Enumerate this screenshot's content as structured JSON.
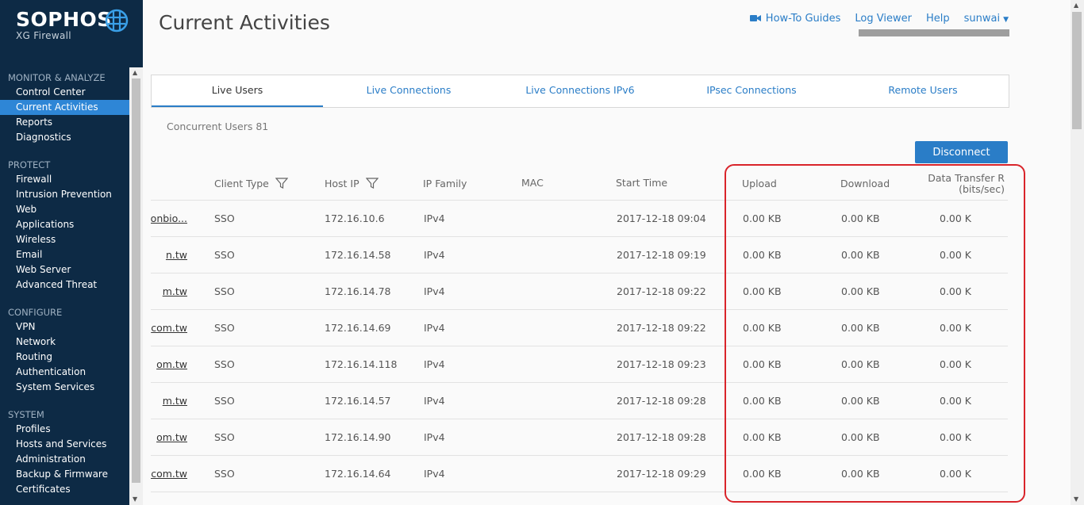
{
  "app": {
    "brand": "SOPHOS",
    "product": "XG Firewall"
  },
  "colors": {
    "sidebar_bg": "#0d2a45",
    "accent": "#2a7dc7",
    "highlight_border": "#d9242a"
  },
  "sidebar": {
    "groups": [
      {
        "header": "MONITOR & ANALYZE",
        "items": [
          "Control Center",
          "Current Activities",
          "Reports",
          "Diagnostics"
        ]
      },
      {
        "header": "PROTECT",
        "items": [
          "Firewall",
          "Intrusion Prevention",
          "Web",
          "Applications",
          "Wireless",
          "Email",
          "Web Server",
          "Advanced Threat"
        ]
      },
      {
        "header": "CONFIGURE",
        "items": [
          "VPN",
          "Network",
          "Routing",
          "Authentication",
          "System Services"
        ]
      },
      {
        "header": "SYSTEM",
        "items": [
          "Profiles",
          "Hosts and Services",
          "Administration",
          "Backup & Firmware",
          "Certificates"
        ]
      }
    ],
    "active_item": "Current Activities"
  },
  "header": {
    "title": "Current Activities",
    "links": {
      "howto": "How-To Guides",
      "log_viewer": "Log Viewer",
      "help": "Help",
      "user": "sunwai"
    }
  },
  "tabs": [
    "Live Users",
    "Live Connections",
    "Live Connections IPv6",
    "IPsec Connections",
    "Remote Users"
  ],
  "active_tab": "Live Users",
  "concurrent_users": "Concurrent Users 81",
  "disconnect_label": "Disconnect",
  "table": {
    "columns": {
      "client_type": "Client Type",
      "host_ip": "Host IP",
      "ip_family": "IP Family",
      "mac": "MAC",
      "start_time": "Start Time",
      "upload": "Upload",
      "download": "Download",
      "dtr_line1": "Data Transfer R",
      "dtr_line2": "(bits/sec)"
    },
    "rows": [
      {
        "user": "onbio...",
        "client_type": "SSO",
        "host_ip": "172.16.10.6",
        "ip_family": "IPv4",
        "mac": "",
        "start_time": "2017-12-18 09:04",
        "upload": "0.00 KB",
        "download": "0.00 KB",
        "rate": "0.00 K"
      },
      {
        "user": "n.tw",
        "client_type": "SSO",
        "host_ip": "172.16.14.58",
        "ip_family": "IPv4",
        "mac": "",
        "start_time": "2017-12-18 09:19",
        "upload": "0.00 KB",
        "download": "0.00 KB",
        "rate": "0.00 K"
      },
      {
        "user": "m.tw",
        "client_type": "SSO",
        "host_ip": "172.16.14.78",
        "ip_family": "IPv4",
        "mac": "",
        "start_time": "2017-12-18 09:22",
        "upload": "0.00 KB",
        "download": "0.00 KB",
        "rate": "0.00 K"
      },
      {
        "user": "com.tw",
        "client_type": "SSO",
        "host_ip": "172.16.14.69",
        "ip_family": "IPv4",
        "mac": "",
        "start_time": "2017-12-18 09:22",
        "upload": "0.00 KB",
        "download": "0.00 KB",
        "rate": "0.00 K"
      },
      {
        "user": "om.tw",
        "client_type": "SSO",
        "host_ip": "172.16.14.118",
        "ip_family": "IPv4",
        "mac": "",
        "start_time": "2017-12-18 09:23",
        "upload": "0.00 KB",
        "download": "0.00 KB",
        "rate": "0.00 K"
      },
      {
        "user": "m.tw",
        "client_type": "SSO",
        "host_ip": "172.16.14.57",
        "ip_family": "IPv4",
        "mac": "",
        "start_time": "2017-12-18 09:28",
        "upload": "0.00 KB",
        "download": "0.00 KB",
        "rate": "0.00 K"
      },
      {
        "user": "om.tw",
        "client_type": "SSO",
        "host_ip": "172.16.14.90",
        "ip_family": "IPv4",
        "mac": "",
        "start_time": "2017-12-18 09:28",
        "upload": "0.00 KB",
        "download": "0.00 KB",
        "rate": "0.00 K"
      },
      {
        "user": ".com.tw",
        "client_type": "SSO",
        "host_ip": "172.16.14.64",
        "ip_family": "IPv4",
        "mac": "",
        "start_time": "2017-12-18 09:29",
        "upload": "0.00 KB",
        "download": "0.00 KB",
        "rate": "0.00 K"
      }
    ]
  }
}
